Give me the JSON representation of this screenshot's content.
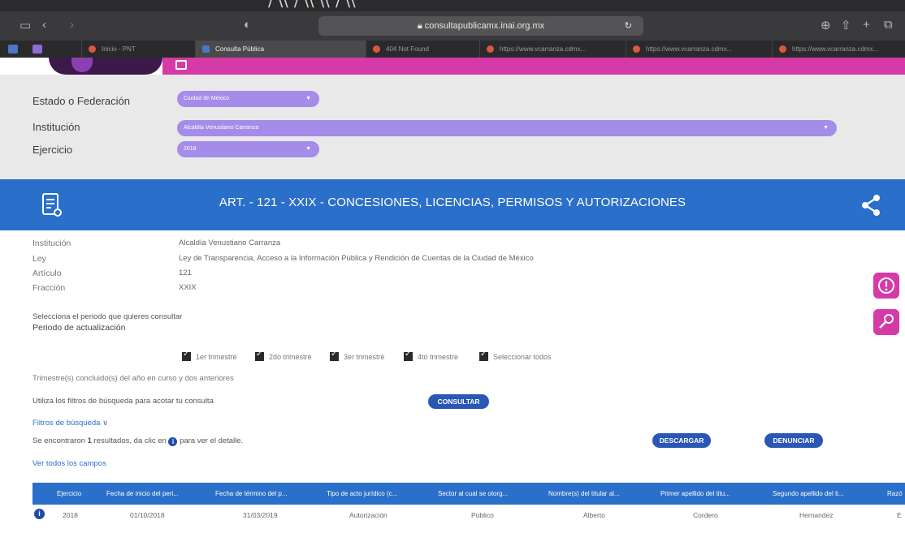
{
  "browser": {
    "top_text": "/ \\\\ / \\\\ \\\\ / \\\\",
    "url": "consultapublicamx.inai.org.mx",
    "tabs": [
      {
        "label": "Inicio - PNT"
      },
      {
        "label": "Consulta Pública"
      },
      {
        "label": "404 Not Found"
      },
      {
        "label": "https://www.vcarranza.cdmx..."
      },
      {
        "label": "https://www.vcarranza.cdmx..."
      },
      {
        "label": "https://www.vcarranza.cdmx..."
      }
    ],
    "colors": {
      "accent_magenta": "#d63aa7",
      "banner_blue": "#2a6fc9",
      "select_purple": "#a48ce8"
    }
  },
  "filters": {
    "estado_label": "Estado o Federación",
    "estado_value": "Ciudad de México",
    "institucion_label": "Institución",
    "institucion_value": "Alcaldía Venustiano Carranza",
    "ejercicio_label": "Ejercicio",
    "ejercicio_value": "2018"
  },
  "banner": {
    "title": "ART. - 121 - XXIX - CONCESIONES, LICENCIAS, PERMISOS Y AUTORIZACIONES",
    "left_icon": "document-person-icon",
    "right_icon": "share-icon"
  },
  "info": {
    "institucion_label": "Institución",
    "institucion_value": "Alcaldía Venustiano Carranza",
    "ley_label": "Ley",
    "ley_value": "Ley de Transparencia, Acceso a la Información Pública y Rendición de Cuentas de la Ciudad de México",
    "articulo_label": "Artículo",
    "articulo_value": "121",
    "fraccion_label": "Fracción",
    "fraccion_value": "XXIX"
  },
  "periodo": {
    "prompt": "Selecciona el periodo que quieres consultar",
    "label": "Periodo de actualización",
    "options": [
      "1er trimestre",
      "2do trimestre",
      "3er trimestre",
      "4to trimestre",
      "Seleccionar todos"
    ],
    "note": "Trimestre(s) concluido(s) del año en curso y dos anteriores"
  },
  "search": {
    "hint": "Utiliza los filtros de búsqueda para acotar tu consulta",
    "consultar": "CONSULTAR",
    "filtros": "Filtros de búsqueda ∨"
  },
  "results": {
    "text_before": "Se encontraron",
    "count": "1",
    "text_mid": "resultados, da clic en",
    "text_after": "para ver el detalle.",
    "descargar": "DESCARGAR",
    "denunciar": "DENUNCIAR",
    "ver_todos": "Ver todos los campos"
  },
  "table": {
    "headers": [
      "Ejercicio",
      "Fecha de inicio del peri...",
      "Fecha de término del p...",
      "Tipo de acto jurídico (c...",
      "Sector al cual se otorg...",
      "Nombre(s) del titular al...",
      "Primer apellido del titu...",
      "Segundo apellido del ti...",
      "Razó"
    ],
    "rows": [
      [
        "2018",
        "01/10/2018",
        "31/03/2019",
        "Autorización",
        "Público",
        "Alberto",
        "Cordero",
        "Hernandez",
        "E"
      ]
    ]
  }
}
